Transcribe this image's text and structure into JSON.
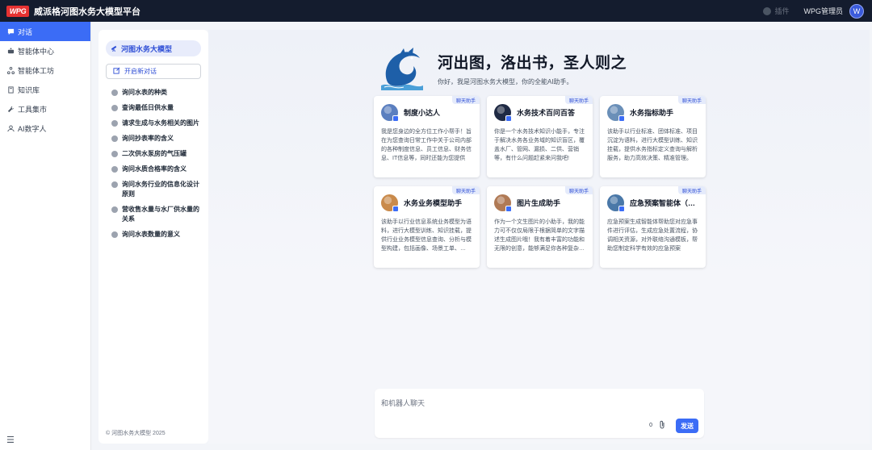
{
  "app": {
    "logo_text": "WPG",
    "title": "威派格河图水务大模型平台"
  },
  "header": {
    "plugin_label": "插件",
    "user_name": "WPG管理员",
    "avatar_letter": "W"
  },
  "nav": {
    "items": [
      {
        "label": "对话",
        "icon": "chat-icon",
        "active": true
      },
      {
        "label": "智能体中心",
        "icon": "robot-icon"
      },
      {
        "label": "智能体工坊",
        "icon": "workflow-icon"
      },
      {
        "label": "知识库",
        "icon": "book-icon"
      },
      {
        "label": "工具集市",
        "icon": "wrench-icon"
      },
      {
        "label": "AI数字人",
        "icon": "user-icon"
      }
    ]
  },
  "conversations": {
    "current_model": "河图水务大模型",
    "new_chat_label": "开启新对话",
    "items": [
      "询问水表的种类",
      "查询最低日供水量",
      "请求生成与水务相关的图片",
      "询问抄表率的含义",
      "二次供水泵房的气压罐",
      "询问水质合格率的含义",
      "询问水务行业的信息化设计原则",
      "营收售水量与水厂供水量的关系",
      "询问水表数量的意义"
    ],
    "copyright": "© 河图水务大模型 2025"
  },
  "hero": {
    "title": "河出图，洛出书，圣人则之",
    "subtitle": "你好，我是河图水务大模型，你的全能AI助手。"
  },
  "cards": [
    {
      "title": "制度小达人",
      "badge": "聊天助手",
      "desc": "我是您身边的全方位工作小帮手！旨在为您查询日常工作中关于公司内部的各种制度信息、员工信息、财务信息、IT信息等，同时还能为您提供图…",
      "color": "#5b7fbf"
    },
    {
      "title": "水务技术百问百答",
      "badge": "聊天助手",
      "desc": "你是一个水务技术知识小能手，专注于解决水务各业务域的知识盲区，覆盖水厂、管网、漏损、二供、营销等，有什么问题赶紧来问我吧!",
      "color": "#1f2a44"
    },
    {
      "title": "水务指标助手",
      "badge": "聊天助手",
      "desc": "该助手以行业标准、团体标准、项目沉淀为语料，进行大模型训练、知识挂载，提供水务指标定义查询与解析服务，助力高效决策、精准管理。",
      "color": "#6a8fb8"
    },
    {
      "title": "水务业务模型助手",
      "badge": "聊天助手",
      "desc": "该助手以行业信息系统业务模型为语料，进行大模型训练、知识挂载，提供行业业务模型信息查询、分析与模型构建，包括画像、场景工单、…",
      "color": "#c98a4b"
    },
    {
      "title": "图片生成助手",
      "badge": "聊天助手",
      "desc": "作为一个文生图片的小助手，我的能力可不仅仅局限于根据简单的文字描述生成图片哦！我有着丰富的功能和无限的创意，能够满足你各种复杂…",
      "color": "#b07a55"
    },
    {
      "title": "应急预案智能体（正…",
      "badge": "聊天助手",
      "desc": "应急预案生成智能体帮助您对应急事件进行评估，生成应急处置流程，协调相关资源，对外联络沟通模板，帮助您制定科学有效的应急预案",
      "color": "#4a78a8"
    }
  ],
  "chat": {
    "placeholder": "和机器人聊天",
    "char_count": "0",
    "send_label": "发送"
  }
}
